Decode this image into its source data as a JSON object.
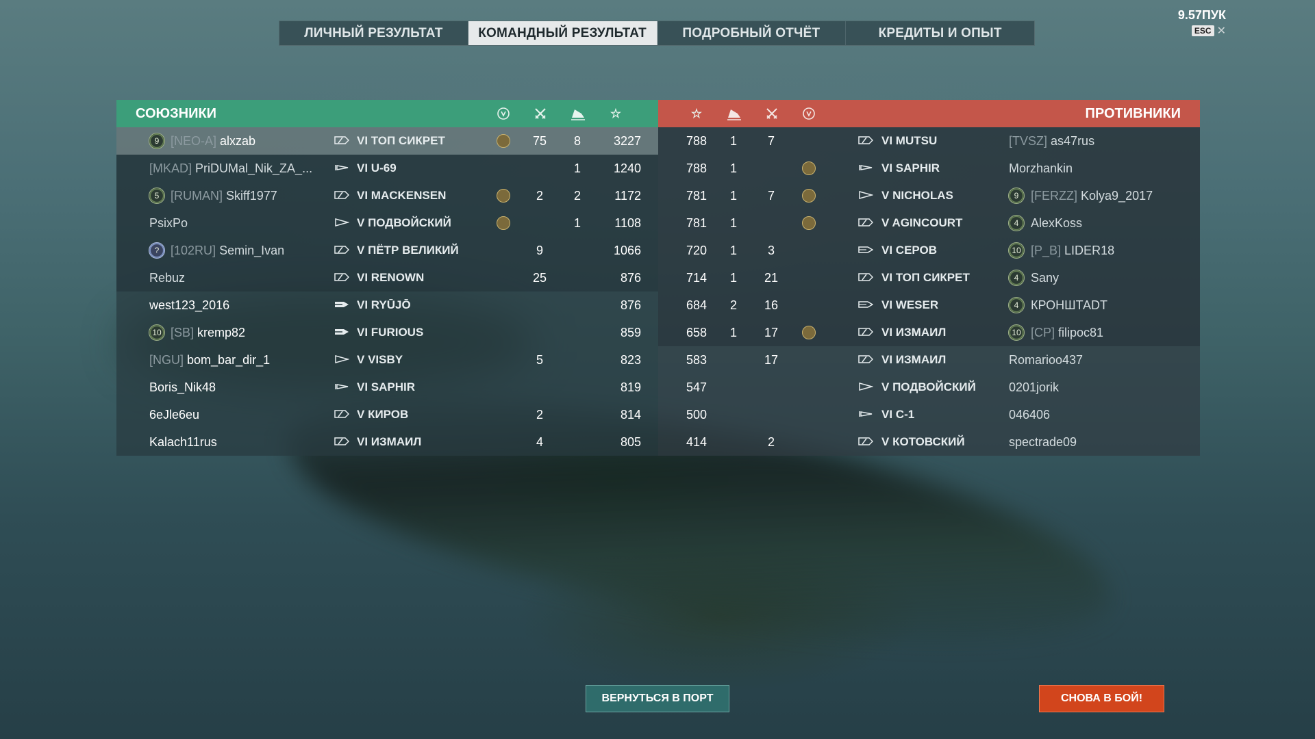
{
  "tabs": [
    {
      "label": "ЛИЧНЫЙ РЕЗУЛЬТАТ",
      "active": false
    },
    {
      "label": "КОМАНДНЫЙ РЕЗУЛЬТАТ",
      "active": true
    },
    {
      "label": "ПОДРОБНЫЙ ОТЧЁТ",
      "active": false
    },
    {
      "label": "КРЕДИТЫ И ОПЫТ",
      "active": false
    }
  ],
  "version": "9.57ПУК",
  "esc_label": "ESC",
  "close_symbol": "✕",
  "allies": {
    "title": "СОЮЗНИКИ",
    "header_icons": [
      "ribbon-icon",
      "crossed-swords-icon",
      "ship-sunk-icon",
      "star-icon"
    ],
    "rows": [
      {
        "rank": "9",
        "clan": "[NEO-A]",
        "name": "alxzab",
        "tier": "VI",
        "ship": "ТОП СИКРЕТ",
        "class_icon": "cruiser",
        "ribbon": true,
        "kills": "75",
        "ships": "8",
        "xp": "3227",
        "style": "hl"
      },
      {
        "rank": "",
        "clan": "[MKAD]",
        "name": "PriDUMal_Nik_ZA_...",
        "tier": "VI",
        "ship": "U-69",
        "class_icon": "submarine",
        "ribbon": false,
        "kills": "",
        "ships": "1",
        "xp": "1240",
        "style": "dark"
      },
      {
        "rank": "5",
        "clan": "[RUMAN]",
        "name": "Skiff1977",
        "tier": "VI",
        "ship": "MACKENSEN",
        "class_icon": "cruiser",
        "ribbon": true,
        "kills": "2",
        "ships": "2",
        "xp": "1172",
        "style": "dark"
      },
      {
        "rank": "",
        "clan": "",
        "name": "PsixPo",
        "tier": "V",
        "ship": "ПОДВОЙСКИЙ",
        "class_icon": "destroyer",
        "ribbon": true,
        "kills": "",
        "ships": "1",
        "xp": "1108",
        "style": "dark"
      },
      {
        "rank": "?",
        "clan": "[102RU]",
        "name": "Semin_Ivan",
        "tier": "V",
        "ship": "ПЁТР ВЕЛИКИЙ",
        "class_icon": "cruiser",
        "ribbon": false,
        "kills": "9",
        "ships": "",
        "xp": "1066",
        "style": "dark"
      },
      {
        "rank": "",
        "clan": "",
        "name": "Rebuz",
        "tier": "VI",
        "ship": "RENOWN",
        "class_icon": "cruiser",
        "ribbon": false,
        "kills": "25",
        "ships": "",
        "xp": "876",
        "style": "dark"
      },
      {
        "rank": "",
        "clan": "",
        "name": "west123_2016",
        "tier": "VI",
        "ship": "RYŪJŌ",
        "class_icon": "carrier",
        "ribbon": false,
        "kills": "",
        "ships": "",
        "xp": "876",
        "style": "plain"
      },
      {
        "rank": "10",
        "clan": "[SB]",
        "name": "kremp82",
        "tier": "VI",
        "ship": "FURIOUS",
        "class_icon": "carrier",
        "ribbon": false,
        "kills": "",
        "ships": "",
        "xp": "859",
        "style": "plain"
      },
      {
        "rank": "",
        "clan": "[NGU]",
        "name": "bom_bar_dir_1",
        "tier": "V",
        "ship": "VISBY",
        "class_icon": "destroyer",
        "ribbon": false,
        "kills": "5",
        "ships": "",
        "xp": "823",
        "style": "plain"
      },
      {
        "rank": "",
        "clan": "",
        "name": "Boris_Nik48",
        "tier": "VI",
        "ship": "SAPHIR",
        "class_icon": "submarine",
        "ribbon": false,
        "kills": "",
        "ships": "",
        "xp": "819",
        "style": "plain"
      },
      {
        "rank": "",
        "clan": "",
        "name": "6eJle6eu",
        "tier": "V",
        "ship": "КИРОВ",
        "class_icon": "cruiser",
        "ribbon": false,
        "kills": "2",
        "ships": "",
        "xp": "814",
        "style": "plain"
      },
      {
        "rank": "",
        "clan": "",
        "name": "Kalach11rus",
        "tier": "VI",
        "ship": "ИЗМАИЛ",
        "class_icon": "cruiser",
        "ribbon": false,
        "kills": "4",
        "ships": "",
        "xp": "805",
        "style": "plain"
      }
    ]
  },
  "enemies": {
    "title": "ПРОТИВНИКИ",
    "header_icons": [
      "star-icon",
      "ship-sunk-icon",
      "crossed-swords-icon",
      "ribbon-icon"
    ],
    "rows": [
      {
        "xp": "788",
        "ships": "1",
        "kills": "7",
        "ribbon": false,
        "tier": "VI",
        "ship": "MUTSU",
        "class_icon": "cruiser",
        "rank": "",
        "clan": "[TVSZ]",
        "name": "as47rus"
      },
      {
        "xp": "788",
        "ships": "1",
        "kills": "",
        "ribbon": true,
        "tier": "VI",
        "ship": "SAPHIR",
        "class_icon": "submarine",
        "rank": "",
        "clan": "",
        "name": "Morzhankin"
      },
      {
        "xp": "781",
        "ships": "1",
        "kills": "7",
        "ribbon": true,
        "tier": "V",
        "ship": "NICHOLAS",
        "class_icon": "destroyer",
        "rank": "9",
        "clan": "[FERZZ]",
        "name": "Kolya9_2017"
      },
      {
        "xp": "781",
        "ships": "1",
        "kills": "",
        "ribbon": true,
        "tier": "V",
        "ship": "AGINCOURT",
        "class_icon": "cruiser",
        "rank": "4",
        "clan": "",
        "name": "AlexKoss"
      },
      {
        "xp": "720",
        "ships": "1",
        "kills": "3",
        "ribbon": false,
        "tier": "VI",
        "ship": "СЕРОВ",
        "class_icon": "carrier-outline",
        "rank": "10",
        "clan": "[P_B]",
        "name": "LIDER18"
      },
      {
        "xp": "714",
        "ships": "1",
        "kills": "21",
        "ribbon": false,
        "tier": "VI",
        "ship": "ТОП СИКРЕТ",
        "class_icon": "cruiser",
        "rank": "4",
        "clan": "",
        "name": "Sany"
      },
      {
        "xp": "684",
        "ships": "2",
        "kills": "16",
        "ribbon": false,
        "tier": "VI",
        "ship": "WESER",
        "class_icon": "carrier-outline",
        "rank": "4",
        "clan": "",
        "name": "КРОНШТАDT"
      },
      {
        "xp": "658",
        "ships": "1",
        "kills": "17",
        "ribbon": true,
        "tier": "VI",
        "ship": "ИЗМАИЛ",
        "class_icon": "cruiser",
        "rank": "10",
        "clan": "[CP]",
        "name": "filipoc81"
      },
      {
        "xp": "583",
        "ships": "",
        "kills": "17",
        "ribbon": false,
        "tier": "VI",
        "ship": "ИЗМАИЛ",
        "class_icon": "cruiser",
        "rank": "",
        "clan": "",
        "name": "Romarioo437"
      },
      {
        "xp": "547",
        "ships": "",
        "kills": "",
        "ribbon": false,
        "tier": "V",
        "ship": "ПОДВОЙСКИЙ",
        "class_icon": "destroyer",
        "rank": "",
        "clan": "",
        "name": "0201jorik"
      },
      {
        "xp": "500",
        "ships": "",
        "kills": "",
        "ribbon": false,
        "tier": "VI",
        "ship": "C-1",
        "class_icon": "submarine",
        "rank": "",
        "clan": "",
        "name": "046406"
      },
      {
        "xp": "414",
        "ships": "",
        "kills": "2",
        "ribbon": false,
        "tier": "V",
        "ship": "КОТОВСКИЙ",
        "class_icon": "cruiser",
        "rank": "",
        "clan": "",
        "name": "spectrade09"
      }
    ]
  },
  "buttons": {
    "to_port": "ВЕРНУТЬСЯ В ПОРТ",
    "battle_again": "СНОВА В БОЙ!"
  },
  "colors": {
    "allies_header": "#3c9e7a",
    "enemies_header": "#c4564a",
    "battle_button": "#d2451c",
    "port_button": "#2f6c6b"
  }
}
